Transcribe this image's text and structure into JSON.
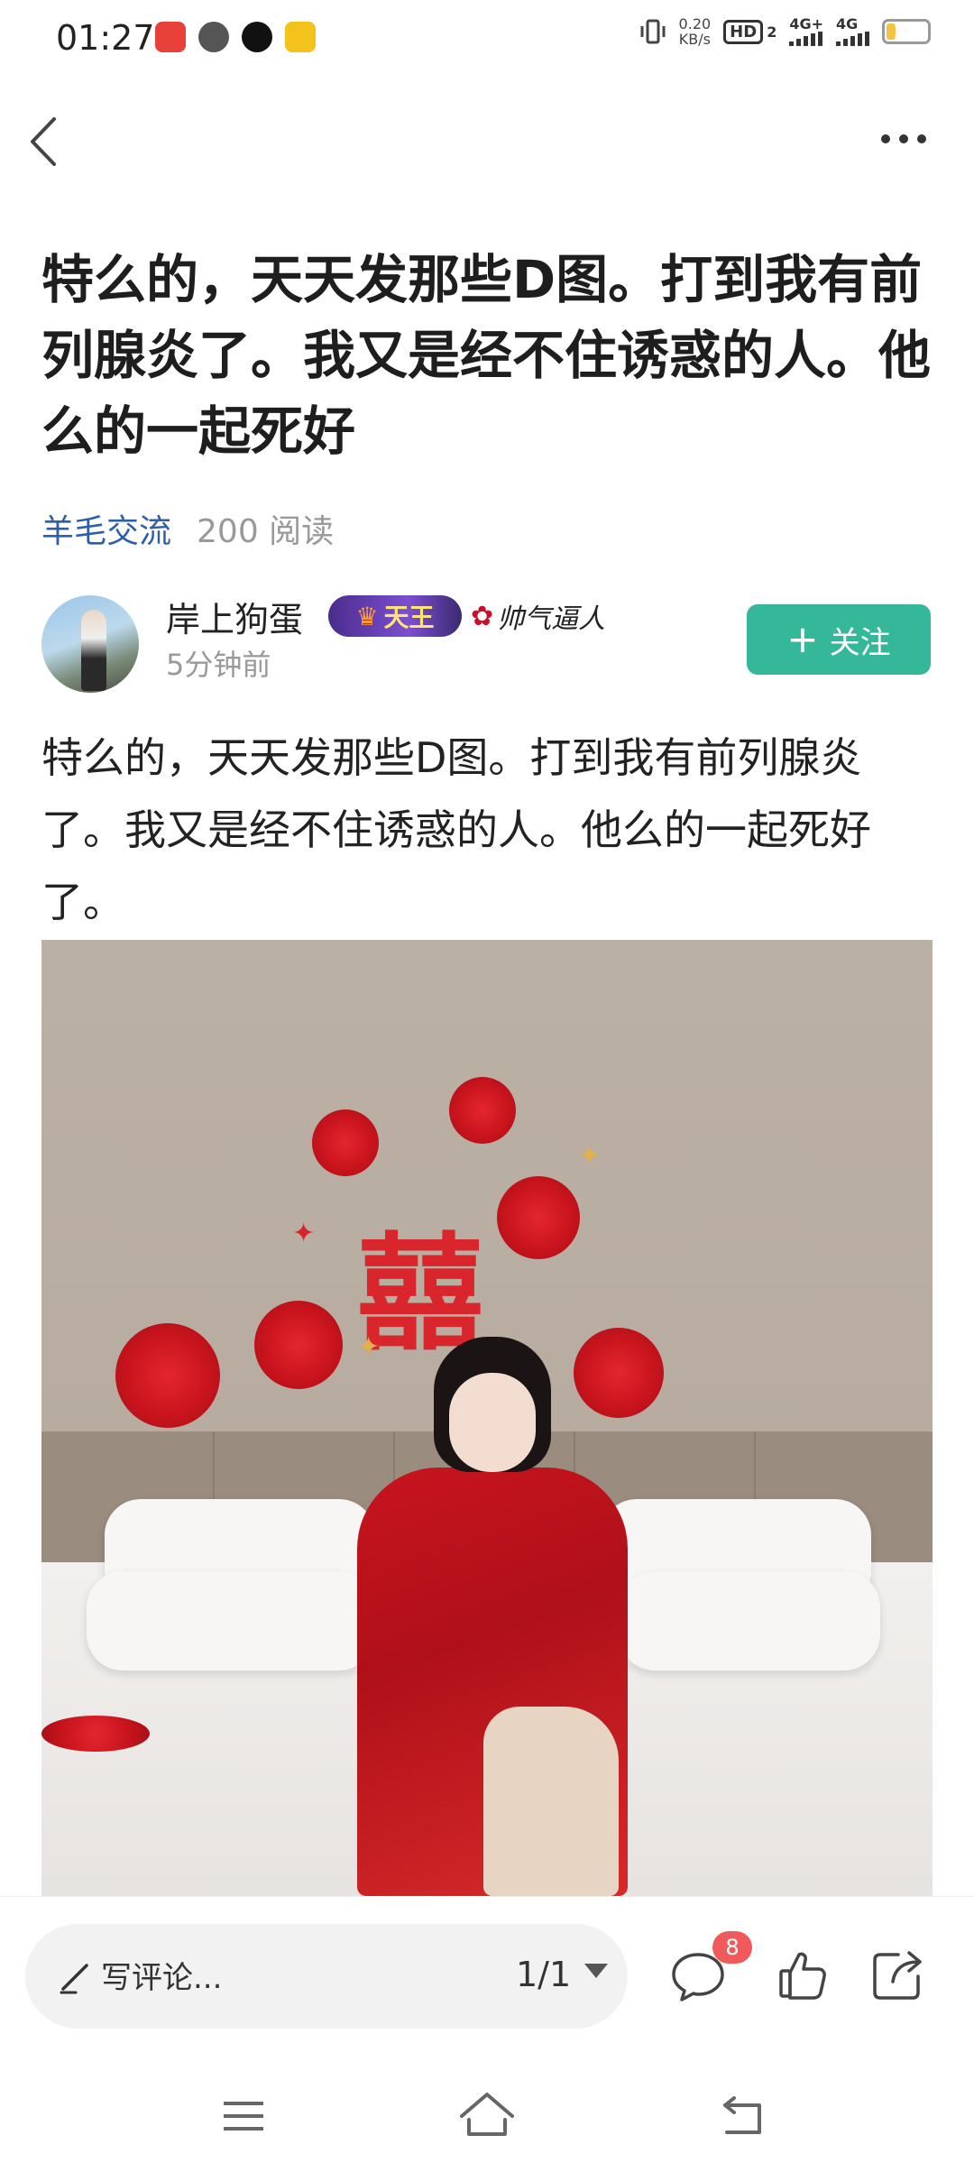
{
  "status_bar": {
    "time": "01:27",
    "net_speed_value": "0.20",
    "net_speed_unit": "KB/s",
    "hd_label": "HD",
    "hd_sub": "2",
    "signal1": "4G+",
    "signal2": "4G",
    "battery": "23",
    "battery_level": 0.23
  },
  "post": {
    "title": "特么的，天天发那些D图。打到我有前列腺炎了。我又是经不住诱惑的人。他么的一起死好",
    "circle": "羊毛交流",
    "reads": "200 阅读",
    "author": {
      "name": "岸上狗蛋",
      "badge_king": "天王",
      "badge_handsome": "帅气逼人",
      "time": "5分钟前"
    },
    "follow_label": "关注",
    "body": "特么的，天天发那些D图。打到我有前列腺炎了。我又是经不住诱惑的人。他么的一起死好了。",
    "image_text": "囍"
  },
  "action_bar": {
    "comment_placeholder": "写评论...",
    "page_indicator": "1/1",
    "comment_count": "8"
  },
  "icons": [
    "back-icon",
    "more-icon",
    "plus-icon",
    "pencil-icon",
    "caret-down-icon",
    "comment-icon",
    "like-icon",
    "share-icon",
    "nav-menu-icon",
    "nav-home-icon",
    "nav-back-icon"
  ],
  "colors": {
    "accent_green": "#35b89a",
    "link_blue": "#2f5ea8",
    "badge_red": "#f05a5a"
  }
}
